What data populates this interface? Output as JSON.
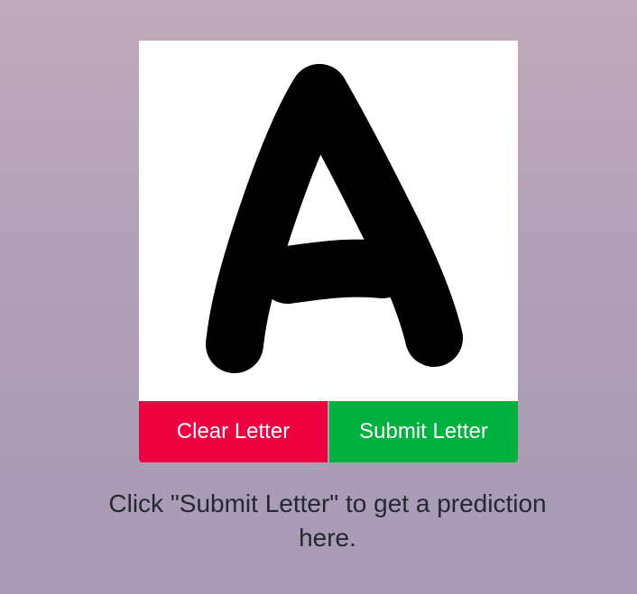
{
  "canvas": {
    "drawn_letter": "A"
  },
  "buttons": {
    "clear_label": "Clear Letter",
    "submit_label": "Submit Letter"
  },
  "prediction": {
    "text": "Click \"Submit Letter\" to get a prediction here."
  },
  "colors": {
    "clear_button": "#ee0141",
    "submit_button": "#00b140",
    "stroke": "#000000",
    "canvas_background": "#ffffff"
  }
}
